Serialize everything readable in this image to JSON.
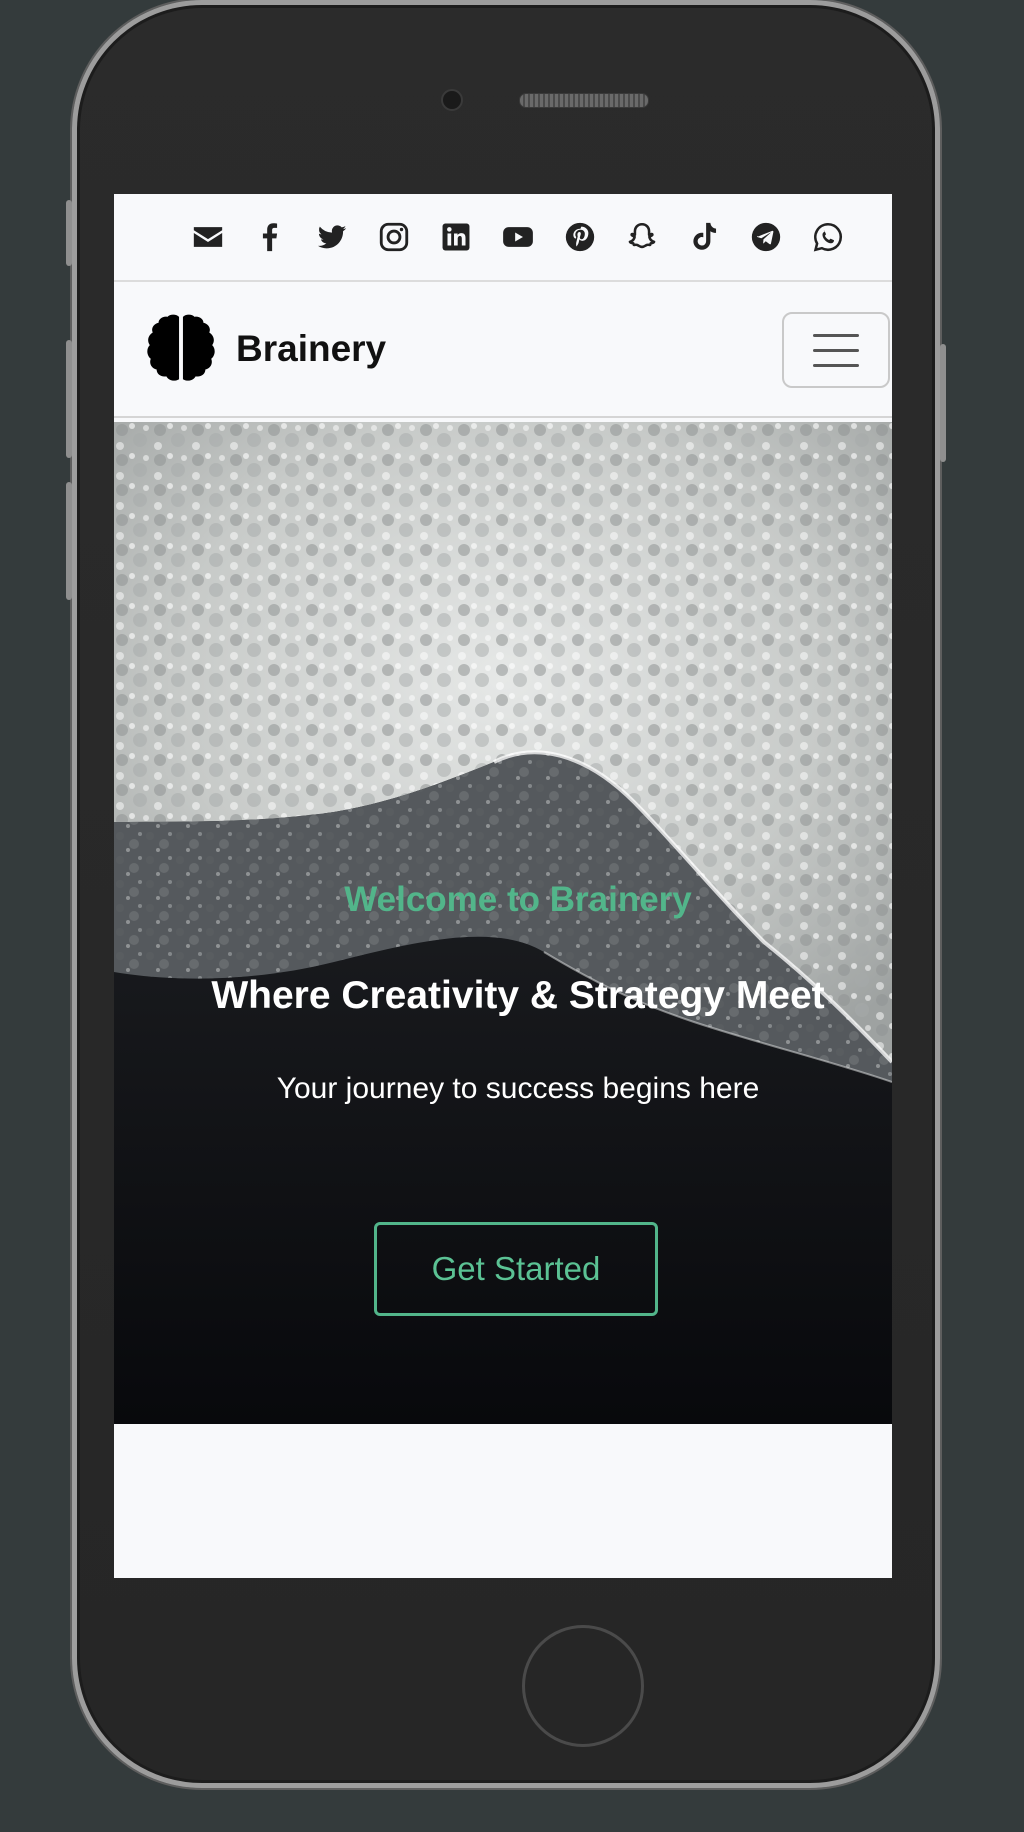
{
  "social": {
    "icons": [
      "envelope-icon",
      "facebook-icon",
      "twitter-icon",
      "instagram-icon",
      "linkedin-icon",
      "youtube-icon",
      "pinterest-icon",
      "snapchat-icon",
      "tiktok-icon",
      "telegram-icon",
      "whatsapp-icon"
    ]
  },
  "navbar": {
    "brand_name": "Brainery",
    "logo_icon": "brain-icon",
    "toggler_icon": "hamburger-icon"
  },
  "hero": {
    "welcome": "Welcome to Brainery",
    "heading": "Where Creativity & Strategy Meet",
    "subheading": "Your journey to success begins here",
    "cta_label": "Get Started"
  },
  "colors": {
    "accent": "#52b58a",
    "page_bg": "#343b3c",
    "screen_bg": "#f8f9fb"
  }
}
